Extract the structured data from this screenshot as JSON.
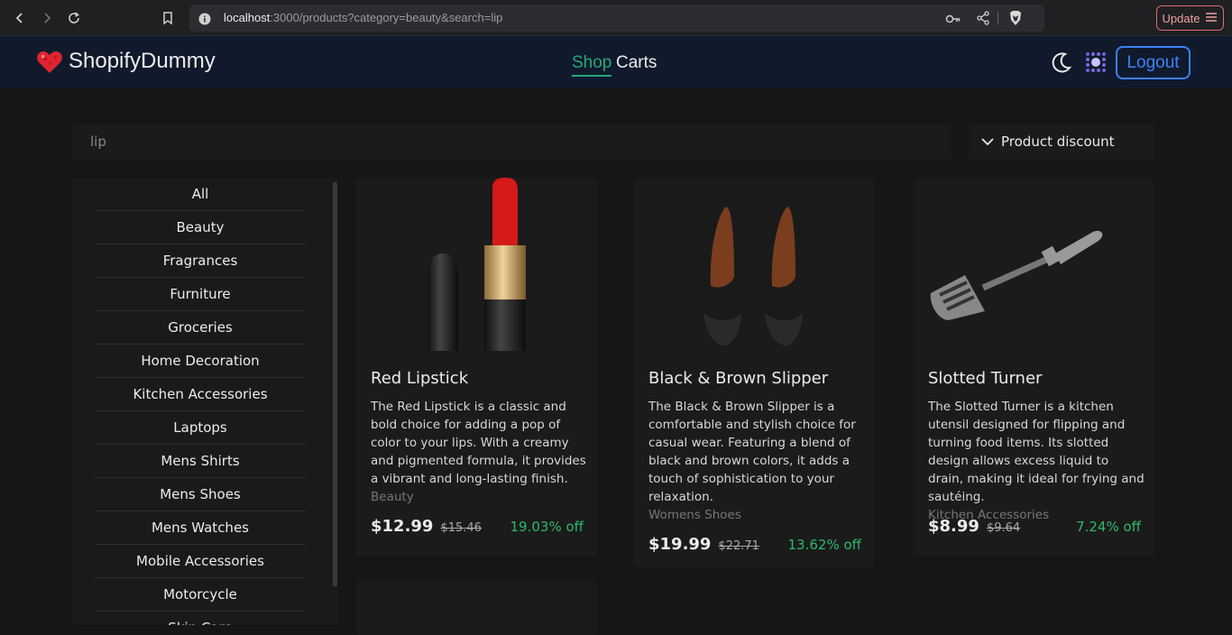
{
  "browser": {
    "url_host": "localhost",
    "url_rest": ":3000/products?category=beauty&search=lip",
    "update_label": "Update"
  },
  "header": {
    "brand": "ShopifyDummy",
    "nav": {
      "shop": "Shop",
      "carts": "Carts"
    },
    "logout_label": "Logout"
  },
  "search": {
    "value": "lip",
    "placeholder": ""
  },
  "discount_select": {
    "label": "Product discount"
  },
  "categories": [
    "All",
    "Beauty",
    "Fragrances",
    "Furniture",
    "Groceries",
    "Home Decoration",
    "Kitchen Accessories",
    "Laptops",
    "Mens Shirts",
    "Mens Shoes",
    "Mens Watches",
    "Mobile Accessories",
    "Motorcycle",
    "Skin Care"
  ],
  "products": [
    {
      "title": "Red Lipstick",
      "description": "The Red Lipstick is a classic and bold choice for adding a pop of color to your lips. With a creamy and pigmented formula, it provides a vibrant and long-lasting finish.",
      "category": "Beauty",
      "price": "$12.99",
      "old_price": "$15.46",
      "discount": "19.03% off"
    },
    {
      "title": "Black & Brown Slipper",
      "description": "The Black & Brown Slipper is a comfortable and stylish choice for casual wear. Featuring a blend of black and brown colors, it adds a touch of sophistication to your relaxation.",
      "category": "Womens Shoes",
      "price": "$19.99",
      "old_price": "$22.71",
      "discount": "13.62% off"
    },
    {
      "title": "Slotted Turner",
      "description": "The Slotted Turner is a kitchen utensil designed for flipping and turning food items. Its slotted design allows excess liquid to drain, making it ideal for frying and sautéing.",
      "category": "Kitchen Accessories",
      "price": "$8.99",
      "old_price": "$9.64",
      "discount": "7.24% off"
    }
  ],
  "colors": {
    "accent_green": "#25a876",
    "logout_blue": "#3b82f6",
    "discount_green": "#2fb86a",
    "header_bg": "#101a2c"
  },
  "icons": [
    "back-icon",
    "forward-icon",
    "reload-icon",
    "bookmark-icon",
    "info-icon",
    "key-icon",
    "share-icon",
    "brave-shield-icon",
    "menu-icon",
    "heart-logo-icon",
    "moon-icon",
    "dots-grid-icon",
    "chevron-down-icon"
  ]
}
